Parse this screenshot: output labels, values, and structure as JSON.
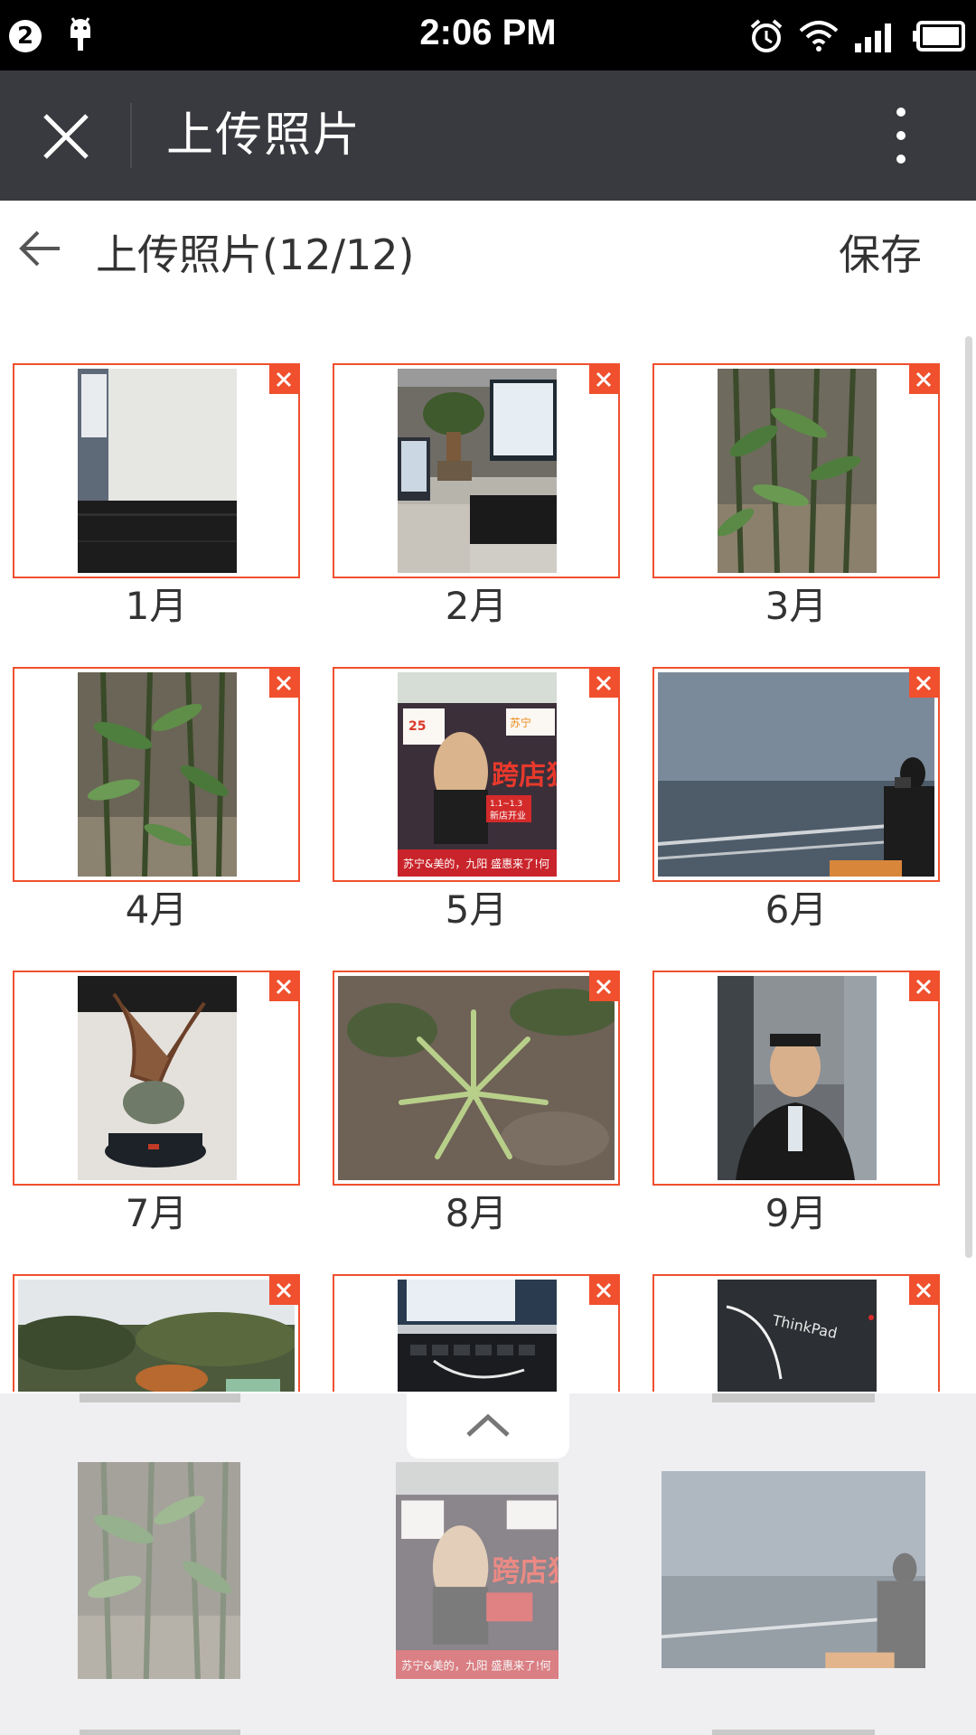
{
  "status_bar": {
    "notification_count": "2",
    "time": "2:06 PM"
  },
  "title_bar": {
    "title": "上传照片"
  },
  "sub_header": {
    "title": "上传照片(12/12)",
    "save_label": "保存"
  },
  "photos": [
    {
      "caption": "1月",
      "icon": "monitor-screen-photo"
    },
    {
      "caption": "2月",
      "icon": "office-desk-photo"
    },
    {
      "caption": "3月",
      "icon": "bamboo-plants-photo"
    },
    {
      "caption": "4月",
      "icon": "bamboo-plants-photo"
    },
    {
      "caption": "5月",
      "icon": "poster-photo"
    },
    {
      "caption": "6月",
      "icon": "sea-view-photo"
    },
    {
      "caption": "7月",
      "icon": "figurine-photo"
    },
    {
      "caption": "8月",
      "icon": "agave-plant-photo"
    },
    {
      "caption": "9月",
      "icon": "portrait-photo"
    },
    {
      "caption": "",
      "icon": "garden-photo"
    },
    {
      "caption": "",
      "icon": "laptop-keyboard-photo"
    },
    {
      "caption": "",
      "icon": "thinkpad-laptop-photo"
    }
  ],
  "poster_text": {
    "logo": "苏宁",
    "headline": "跨店狂欢",
    "date": "1.1~1.3",
    "event": "新店开业",
    "banner": "苏宁&美的，九阳 盛惠来了!何"
  },
  "thinkpad_label": "ThinkPad",
  "drawer": {
    "toggle_icon": "chevron-up-icon"
  },
  "colors": {
    "accent": "#f0502e",
    "title_bar": "#393a3f",
    "status_bar": "#000000",
    "drawer_bg": "#efeff1"
  }
}
